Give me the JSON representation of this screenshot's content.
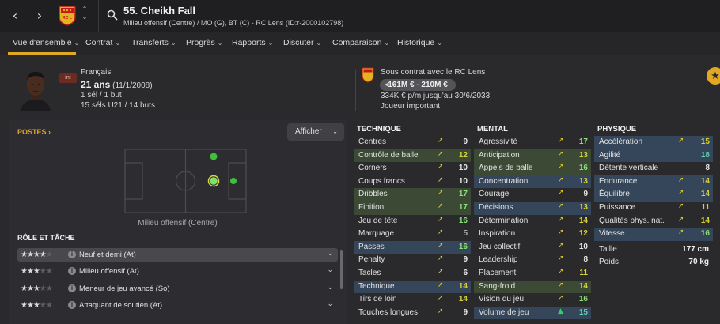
{
  "header": {
    "back_icon": "chevron-left-icon",
    "forward_icon": "chevron-right-icon",
    "player_title": "55. Cheikh Fall",
    "player_subtitle": "Milieu offensif (Centre) / MO (G), BT (C) - RC Lens (ID:r-2000102798)",
    "club_crest_text": "RC L"
  },
  "tabs": [
    {
      "label": "Vue d'ensemble"
    },
    {
      "label": "Contrat"
    },
    {
      "label": "Transferts"
    },
    {
      "label": "Progrès"
    },
    {
      "label": "Rapports"
    },
    {
      "label": "Discuter"
    },
    {
      "label": "Comparaison"
    },
    {
      "label": "Historique"
    }
  ],
  "profile": {
    "int_badge": "int",
    "nationality": "Français",
    "age": "21 ans",
    "birthdate": "(11/1/2008)",
    "caps": "1 sél / 1 but",
    "u21": "15 séls U21 / 14 buts",
    "contract_status": "Sous contrat avec le RC Lens",
    "value_range": "161M € - 210M €",
    "wage": "334K € p/m jusqu'au 30/6/2033",
    "squad_status": "Joueur important"
  },
  "positions": {
    "label": "POSTES",
    "show_button": "Afficher",
    "position_label": "Milieu offensif (Centre)"
  },
  "roles": {
    "title": "RÔLE ET TÂCHE",
    "items": [
      {
        "stars": "★★★★",
        "stars_off": "★",
        "name": "Neuf et demi (At)",
        "selected": true
      },
      {
        "stars": "★★★",
        "stars_off": "★★",
        "name": "Milieu offensif (At)",
        "selected": false
      },
      {
        "stars": "★★★",
        "stars_off": "★★",
        "name": "Meneur de jeu avancé (So)",
        "selected": false
      },
      {
        "stars": "★★★",
        "stars_off": "★★",
        "name": "Attaquant de soutien (At)",
        "selected": false
      }
    ]
  },
  "technique": {
    "title": "TECHNIQUE",
    "items": [
      {
        "name": "Centres",
        "trend": "➚",
        "value": "9"
      },
      {
        "name": "Contrôle de balle",
        "trend": "➚",
        "value": "12"
      },
      {
        "name": "Corners",
        "trend": "➚",
        "value": "10"
      },
      {
        "name": "Coups francs",
        "trend": "➚",
        "value": "10"
      },
      {
        "name": "Dribbles",
        "trend": "➚",
        "value": "17"
      },
      {
        "name": "Finition",
        "trend": "➚",
        "value": "17"
      },
      {
        "name": "Jeu de tête",
        "trend": "➚",
        "value": "16"
      },
      {
        "name": "Marquage",
        "trend": "➚",
        "value": "5"
      },
      {
        "name": "Passes",
        "trend": "➚",
        "value": "16"
      },
      {
        "name": "Penalty",
        "trend": "➚",
        "value": "9"
      },
      {
        "name": "Tacles",
        "trend": "➚",
        "value": "6"
      },
      {
        "name": "Technique",
        "trend": "➚",
        "value": "14"
      },
      {
        "name": "Tirs de loin",
        "trend": "➚",
        "value": "14"
      },
      {
        "name": "Touches longues",
        "trend": "➚",
        "value": "9"
      }
    ]
  },
  "mental": {
    "title": "MENTAL",
    "items": [
      {
        "name": "Agressivité",
        "trend": "➚",
        "value": "17"
      },
      {
        "name": "Anticipation",
        "trend": "➚",
        "value": "13"
      },
      {
        "name": "Appels de balle",
        "trend": "➚",
        "value": "16"
      },
      {
        "name": "Concentration",
        "trend": "➚",
        "value": "13"
      },
      {
        "name": "Courage",
        "trend": "➚",
        "value": "9"
      },
      {
        "name": "Décisions",
        "trend": "➚",
        "value": "13"
      },
      {
        "name": "Détermination",
        "trend": "➚",
        "value": "14"
      },
      {
        "name": "Inspiration",
        "trend": "➚",
        "value": "12"
      },
      {
        "name": "Jeu collectif",
        "trend": "➚",
        "value": "10"
      },
      {
        "name": "Leadership",
        "trend": "➚",
        "value": "8"
      },
      {
        "name": "Placement",
        "trend": "➚",
        "value": "11"
      },
      {
        "name": "Sang-froid",
        "trend": "➚",
        "value": "14"
      },
      {
        "name": "Vision du jeu",
        "trend": "➚",
        "value": "16"
      },
      {
        "name": "Volume de jeu",
        "trend": "▲",
        "value": "15"
      }
    ]
  },
  "physique": {
    "title": "PHYSIQUE",
    "items": [
      {
        "name": "Accélération",
        "trend": "➚",
        "value": "15"
      },
      {
        "name": "Agilité",
        "trend": "",
        "value": "18"
      },
      {
        "name": "Détente verticale",
        "trend": "",
        "value": "8"
      },
      {
        "name": "Endurance",
        "trend": "➚",
        "value": "14"
      },
      {
        "name": "Équilibre",
        "trend": "➚",
        "value": "14"
      },
      {
        "name": "Puissance",
        "trend": "➚",
        "value": "11"
      },
      {
        "name": "Qualités phys. nat.",
        "trend": "➚",
        "value": "14"
      },
      {
        "name": "Vitesse",
        "trend": "➚",
        "value": "16"
      }
    ],
    "height_label": "Taille",
    "height_value": "177 cm",
    "weight_label": "Poids",
    "weight_value": "70 kg"
  },
  "colors": {
    "accent": "#e0a824",
    "highlight_green": "#3c4a35",
    "highlight_blue": "#35455a"
  }
}
